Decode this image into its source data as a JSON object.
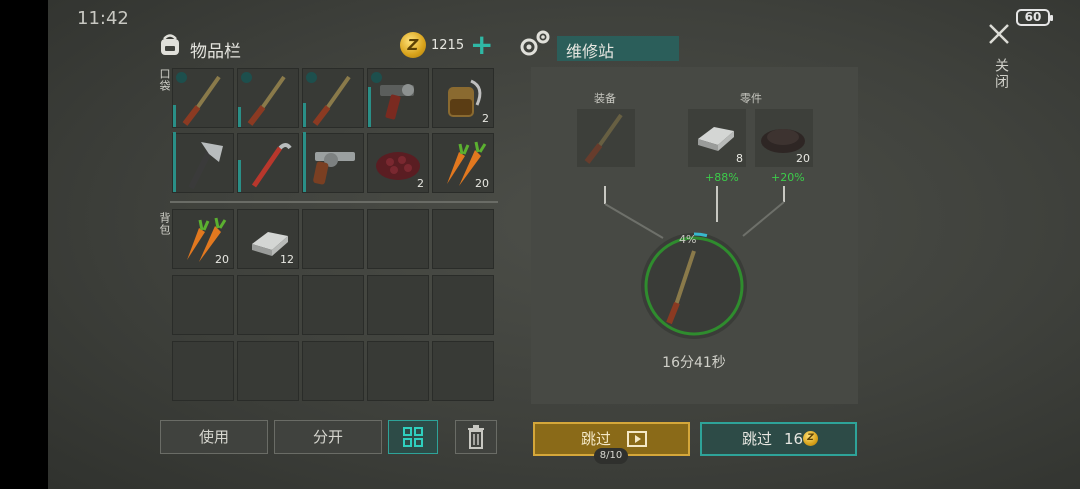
{
  "status": {
    "time": "11:42",
    "battery": "60"
  },
  "inventory": {
    "title": "物品栏",
    "coins": "1215",
    "pocket_label": "口袋",
    "backpack_label": "背包",
    "pocket_slots": [
      {
        "item": "shotgun-double-barrel",
        "qty": ""
      },
      {
        "item": "shotgun-double-barrel",
        "qty": ""
      },
      {
        "item": "shotgun-double-barrel",
        "qty": ""
      },
      {
        "item": "revolver-flare-gun",
        "qty": ""
      },
      {
        "item": "fuel-canister",
        "qty": "2"
      },
      {
        "item": "hatchet",
        "qty": ""
      },
      {
        "item": "crowbar",
        "qty": ""
      },
      {
        "item": "revolver",
        "qty": ""
      },
      {
        "item": "berries",
        "qty": "2"
      },
      {
        "item": "carrots",
        "qty": "20"
      }
    ],
    "backpack_slots": [
      {
        "item": "carrots",
        "qty": "20"
      },
      {
        "item": "metal-ingot",
        "qty": "12"
      }
    ],
    "buttons": {
      "use": "使用",
      "split": "分开"
    }
  },
  "repair": {
    "title": "维修站",
    "equipment_label": "装备",
    "parts_label": "零件",
    "part1_qty": "8",
    "part1_bonus": "+88%",
    "part2_qty": "20",
    "part2_bonus": "+20%",
    "progress_pct": "4%",
    "progress_value": 0.04,
    "timer": "16分41秒",
    "skip_ad_label": "跳过",
    "ad_count": "8/10",
    "skip_coin_label": "跳过",
    "skip_cost": "16"
  },
  "close_label": "关闭",
  "colors": {
    "accent": "#2ea399",
    "gold": "#d5a73a",
    "bonus": "#3ccc4a"
  }
}
